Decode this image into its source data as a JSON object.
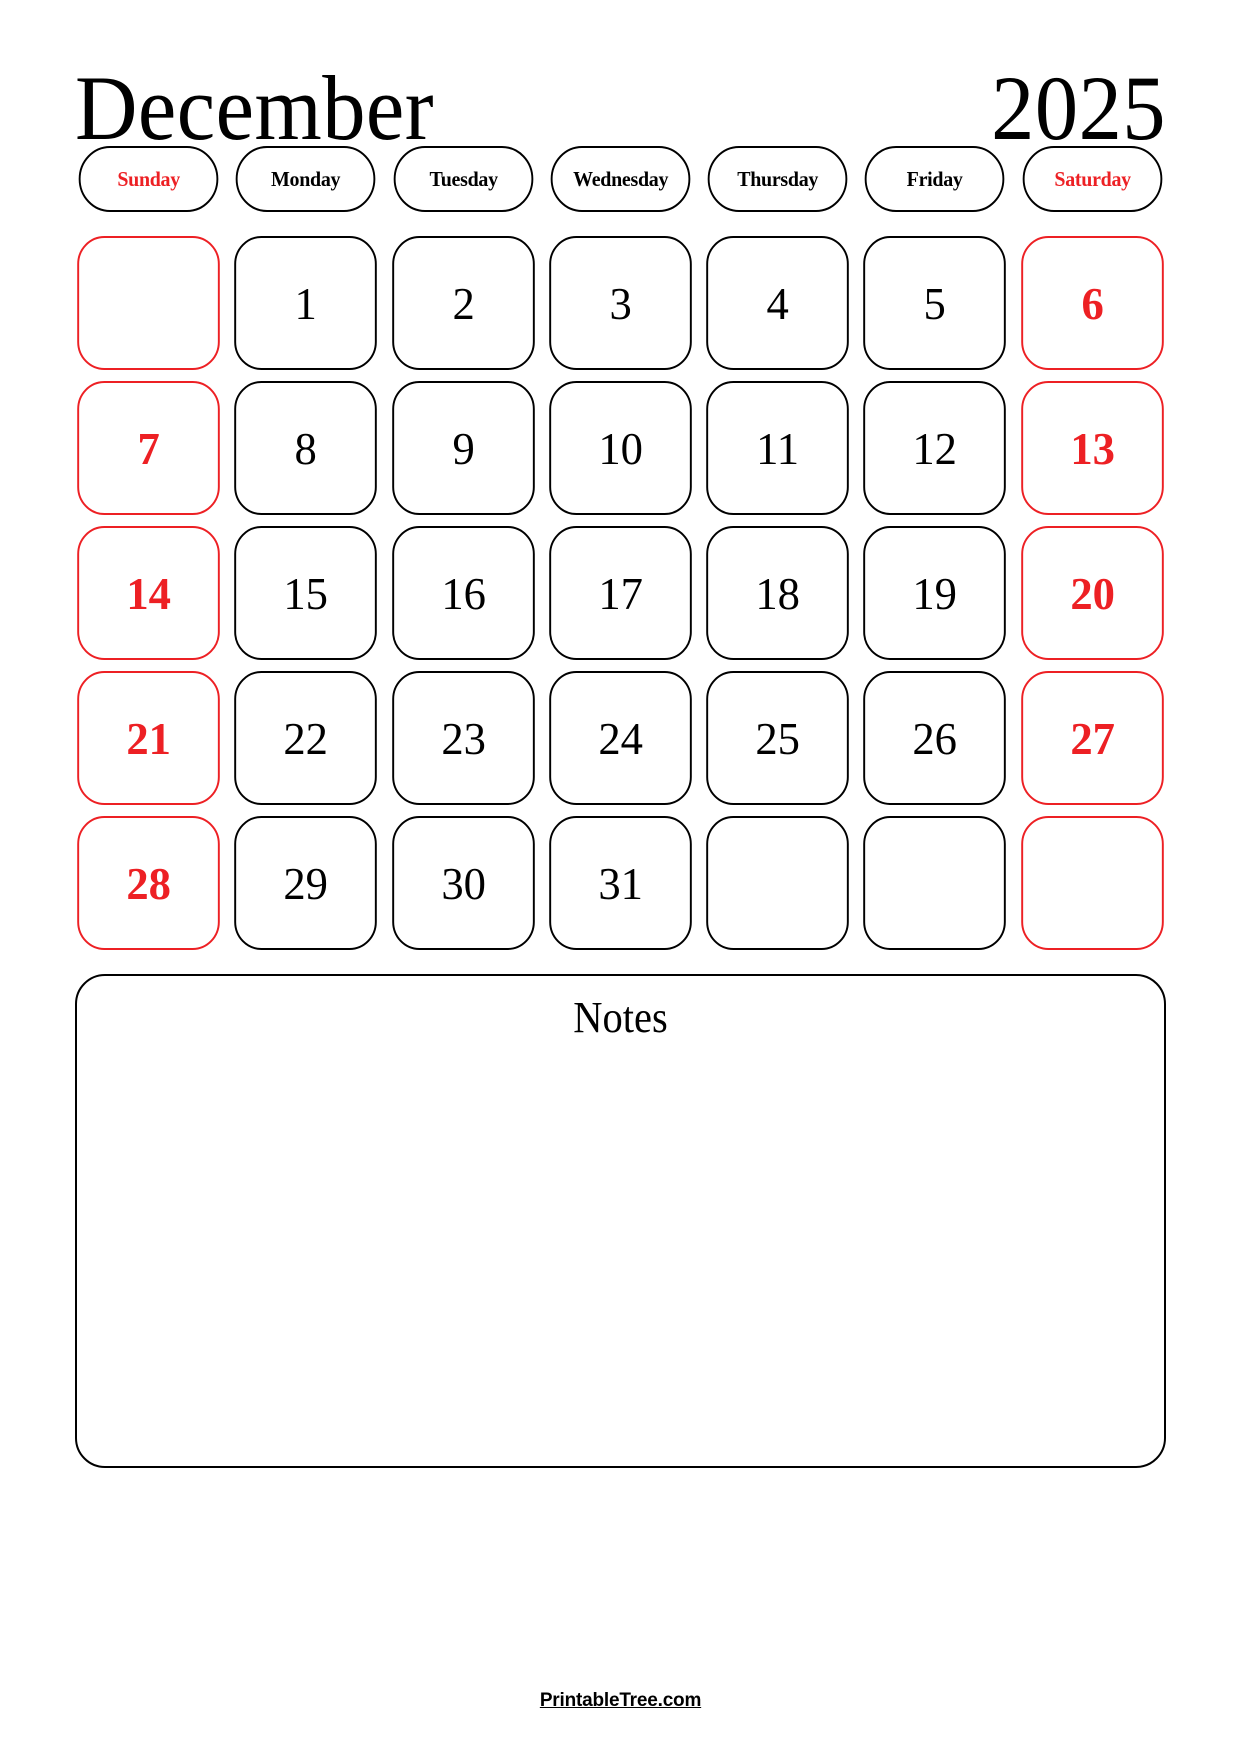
{
  "calendar": {
    "month": "December",
    "year": "2025",
    "accent_color": "#ED2024",
    "text_color": "#000000",
    "background_color": "#FFFFFF",
    "weekday_headers": [
      {
        "label": "Sunday",
        "weekend": true
      },
      {
        "label": "Monday",
        "weekend": false
      },
      {
        "label": "Tuesday",
        "weekend": false
      },
      {
        "label": "Wednesday",
        "weekend": false
      },
      {
        "label": "Thursday",
        "weekend": false
      },
      {
        "label": "Friday",
        "weekend": false
      },
      {
        "label": "Saturday",
        "weekend": true
      }
    ],
    "weeks": [
      [
        {
          "day": "",
          "weekend": true,
          "empty": true
        },
        {
          "day": "1",
          "weekend": false,
          "empty": false
        },
        {
          "day": "2",
          "weekend": false,
          "empty": false
        },
        {
          "day": "3",
          "weekend": false,
          "empty": false
        },
        {
          "day": "4",
          "weekend": false,
          "empty": false
        },
        {
          "day": "5",
          "weekend": false,
          "empty": false
        },
        {
          "day": "6",
          "weekend": true,
          "empty": false
        }
      ],
      [
        {
          "day": "7",
          "weekend": true,
          "empty": false
        },
        {
          "day": "8",
          "weekend": false,
          "empty": false
        },
        {
          "day": "9",
          "weekend": false,
          "empty": false
        },
        {
          "day": "10",
          "weekend": false,
          "empty": false
        },
        {
          "day": "11",
          "weekend": false,
          "empty": false
        },
        {
          "day": "12",
          "weekend": false,
          "empty": false
        },
        {
          "day": "13",
          "weekend": true,
          "empty": false
        }
      ],
      [
        {
          "day": "14",
          "weekend": true,
          "empty": false
        },
        {
          "day": "15",
          "weekend": false,
          "empty": false
        },
        {
          "day": "16",
          "weekend": false,
          "empty": false
        },
        {
          "day": "17",
          "weekend": false,
          "empty": false
        },
        {
          "day": "18",
          "weekend": false,
          "empty": false
        },
        {
          "day": "19",
          "weekend": false,
          "empty": false
        },
        {
          "day": "20",
          "weekend": true,
          "empty": false
        }
      ],
      [
        {
          "day": "21",
          "weekend": true,
          "empty": false
        },
        {
          "day": "22",
          "weekend": false,
          "empty": false
        },
        {
          "day": "23",
          "weekend": false,
          "empty": false
        },
        {
          "day": "24",
          "weekend": false,
          "empty": false
        },
        {
          "day": "25",
          "weekend": false,
          "empty": false
        },
        {
          "day": "26",
          "weekend": false,
          "empty": false
        },
        {
          "day": "27",
          "weekend": true,
          "empty": false
        }
      ],
      [
        {
          "day": "28",
          "weekend": true,
          "empty": false
        },
        {
          "day": "29",
          "weekend": false,
          "empty": false
        },
        {
          "day": "30",
          "weekend": false,
          "empty": false
        },
        {
          "day": "31",
          "weekend": false,
          "empty": false
        },
        {
          "day": "",
          "weekend": false,
          "empty": true
        },
        {
          "day": "",
          "weekend": false,
          "empty": true
        },
        {
          "day": "",
          "weekend": true,
          "empty": true
        }
      ]
    ]
  },
  "notes": {
    "title": "Notes",
    "value": "",
    "placeholder": ""
  },
  "footer": {
    "link_label": "PrintableTree.com"
  }
}
